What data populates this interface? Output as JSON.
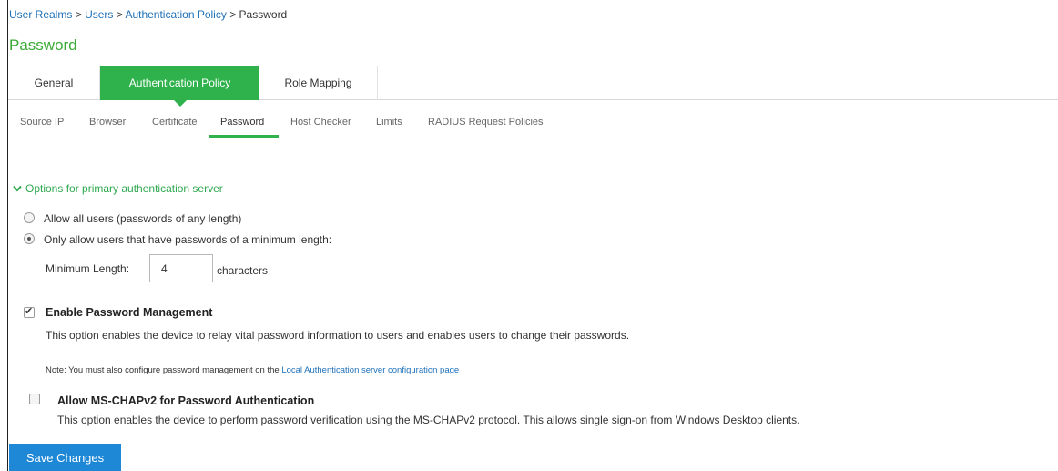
{
  "breadcrumb": {
    "items": [
      "User Realms",
      "Users",
      "Authentication Policy"
    ],
    "separator": ">",
    "current": "Password"
  },
  "page_title": "Password",
  "main_tabs": [
    {
      "label": "General",
      "active": false
    },
    {
      "label": "Authentication Policy",
      "active": true
    },
    {
      "label": "Role Mapping",
      "active": false
    }
  ],
  "sub_tabs": [
    {
      "label": "Source IP",
      "active": false
    },
    {
      "label": "Browser",
      "active": false
    },
    {
      "label": "Certificate",
      "active": false
    },
    {
      "label": "Password",
      "active": true
    },
    {
      "label": "Host Checker",
      "active": false
    },
    {
      "label": "Limits",
      "active": false
    },
    {
      "label": "RADIUS Request Policies",
      "active": false
    }
  ],
  "section": {
    "title": "Options for primary authentication server",
    "icon": "chevron-down-icon"
  },
  "options": {
    "allow_all": {
      "label": "Allow all users (passwords of any length)",
      "selected": false
    },
    "min_length": {
      "label": "Only allow users that have passwords of a minimum length:",
      "selected": true
    }
  },
  "min_length_field": {
    "label": "Minimum Length:",
    "value": "4",
    "unit": "characters"
  },
  "password_management": {
    "checked": true,
    "label": "Enable Password Management",
    "description": "This option enables the device to relay vital password information to users and enables users to change their passwords.",
    "note_prefix": "Note: You must also configure password management on the",
    "note_link": "Local Authentication server configuration page"
  },
  "ms_chap": {
    "checked": false,
    "label": "Allow MS-CHAPv2 for Password Authentication",
    "description": "This option enables the device to perform password verification using the MS-CHAPv2 protocol. This allows single sign-on from Windows Desktop clients."
  },
  "save_button": "Save Changes",
  "colors": {
    "accent_green": "#2fb24c",
    "title_green": "#3aaa35",
    "link_blue": "#1d70b8",
    "button_blue": "#1f88d6"
  }
}
